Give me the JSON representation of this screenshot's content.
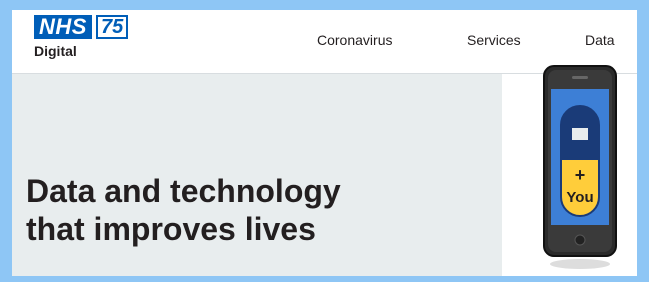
{
  "header": {
    "logo": {
      "nhs": "NHS",
      "number": "75",
      "subtitle": "Digital"
    },
    "nav": [
      "Coronavirus",
      "Services",
      "Data"
    ]
  },
  "hero": {
    "title_line1": "Data and technology",
    "title_line2": "that improves lives"
  },
  "phone": {
    "pill_symbol": "+",
    "pill_label": "You"
  },
  "colors": {
    "brand_blue": "#005eb8",
    "hero_bg": "#e8edee",
    "frame_bg": "#8ec6f5",
    "pill_yellow": "#ffcd3a"
  },
  "icons": [
    "phone-illustration-icon",
    "nhs-crest-icon"
  ]
}
